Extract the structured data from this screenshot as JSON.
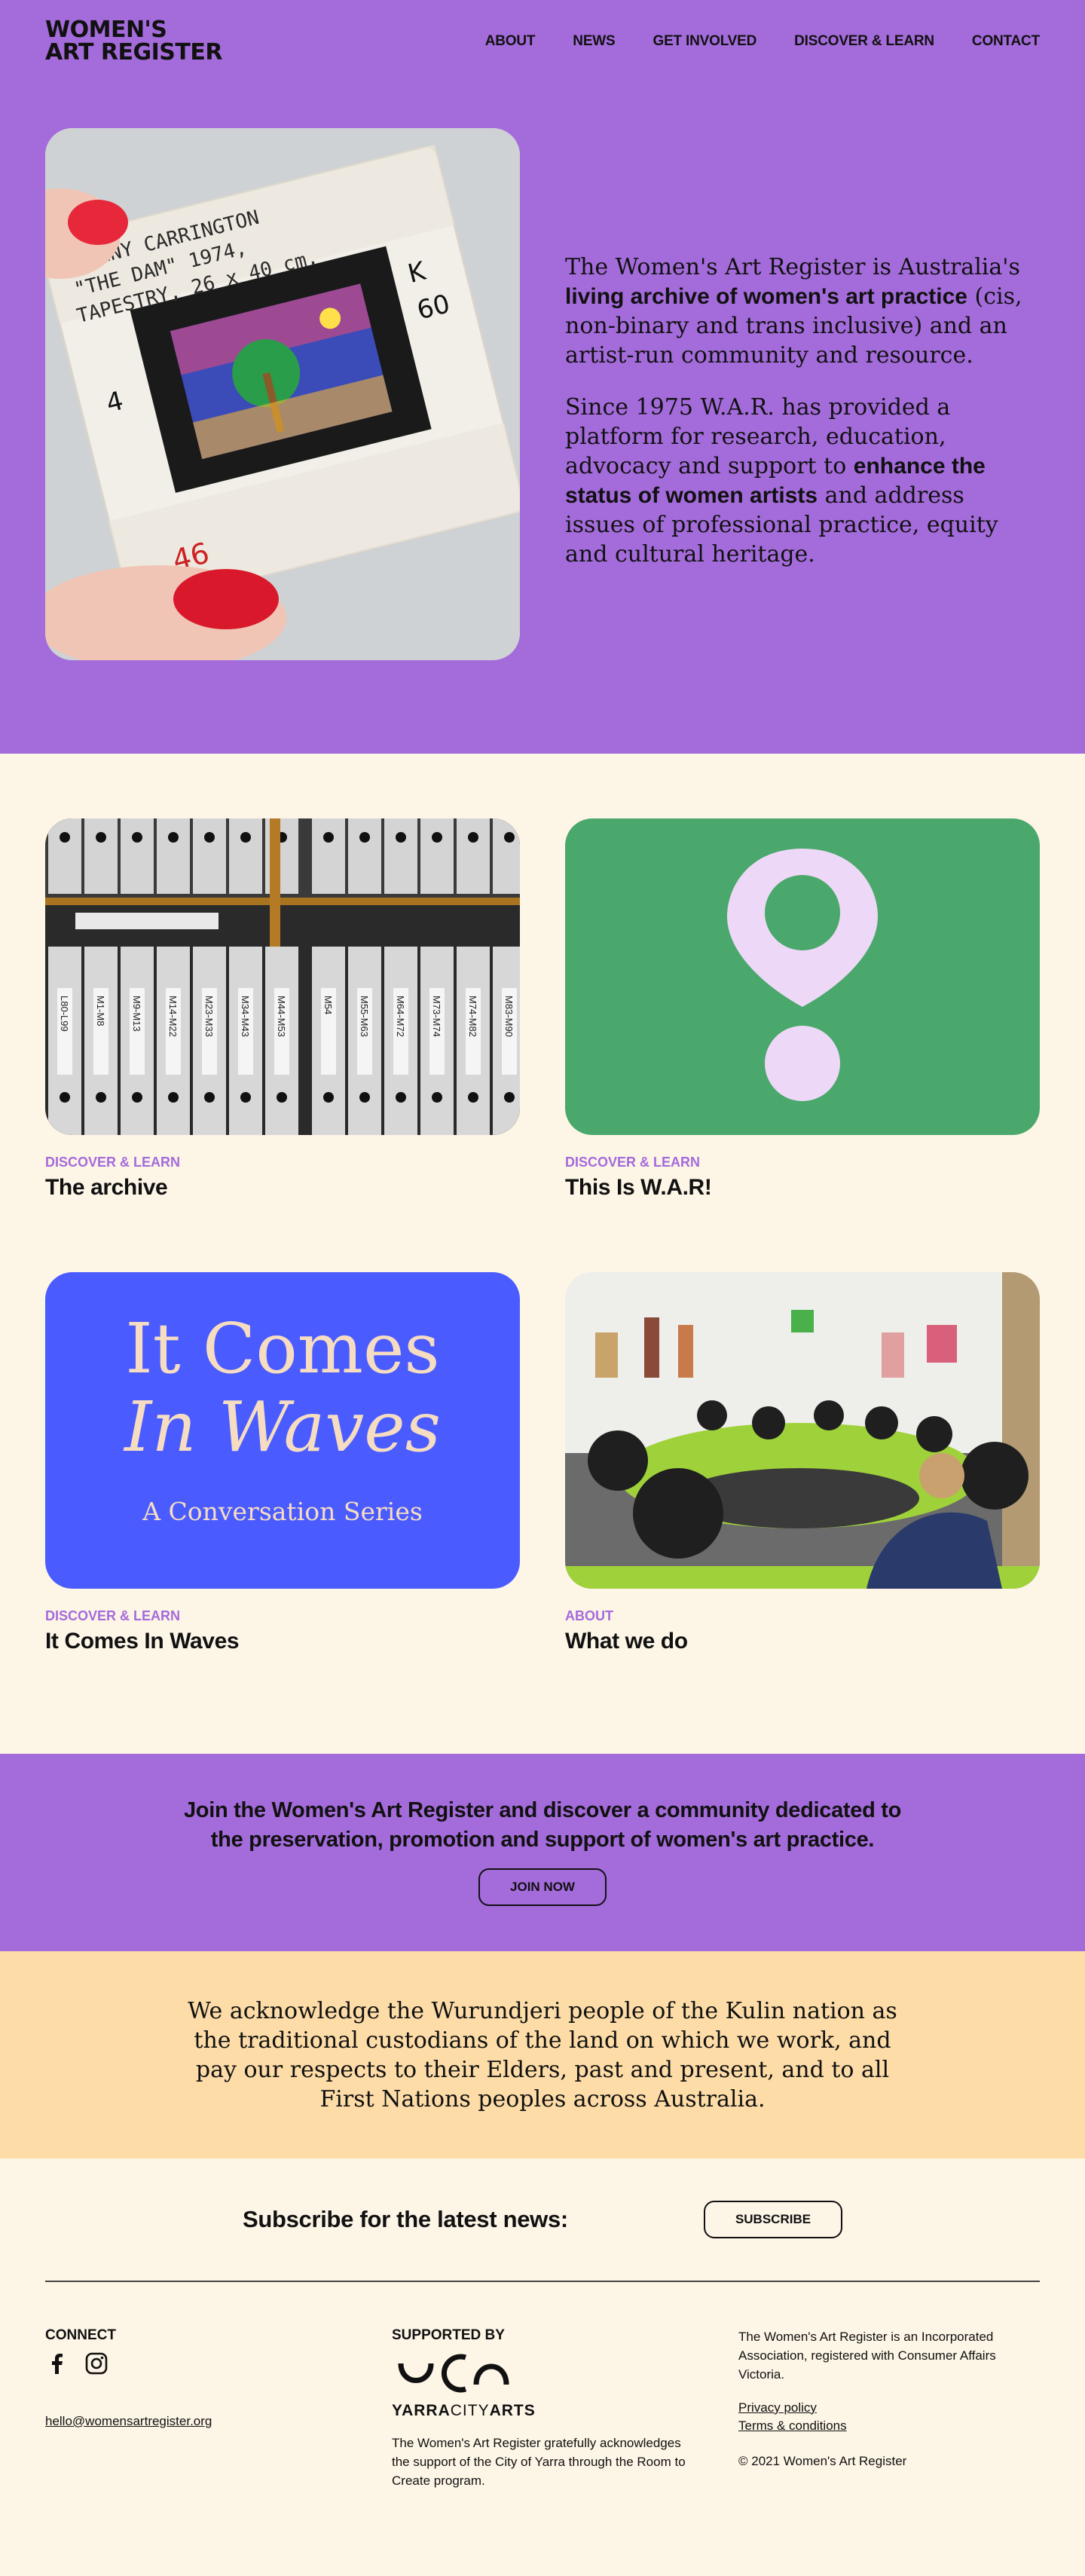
{
  "header": {
    "logo_line1": "WOMEN'S",
    "logo_line2": "ART REGISTER",
    "nav": [
      "ABOUT",
      "NEWS",
      "GET INVOLVED",
      "DISCOVER & LEARN",
      "CONTACT"
    ]
  },
  "hero": {
    "slide_handwriting": [
      "JENNY CARRINGTON",
      "\"THE DAM\" 1974,",
      "TAPESTRY, 26 x 40 cm."
    ],
    "slide_marks": [
      "K",
      "60",
      "4",
      "46"
    ],
    "p1_pre": "The Women's Art Register is Australia's ",
    "p1_bold": "living archive of women's art practice",
    "p1_post": " (cis, non-binary and trans inclusive) and an artist-run community and resource.",
    "p2_pre": "Since 1975 W.A.R. has provided a platform for research, education, advocacy and support to ",
    "p2_bold": "enhance the status of women artists",
    "p2_post": " and address issues of professional practice, equity and cultural heritage."
  },
  "cards": [
    {
      "category": "DISCOVER & LEARN",
      "title": "The archive",
      "binder_labels": [
        "L80-L99",
        "M1-M8",
        "M9-M13",
        "M14-M22",
        "M23-M33",
        "M34-M43",
        "M44-M53",
        "M54",
        "M55-M63",
        "M64-M72",
        "M73-M74",
        "M74-M82",
        "M83-M90"
      ]
    },
    {
      "category": "DISCOVER & LEARN",
      "title": "This Is W.A.R!"
    },
    {
      "category": "DISCOVER & LEARN",
      "title": "It Comes In Waves",
      "art_line1": "It Comes",
      "art_line2": "In Waves",
      "art_sub": "A Conversation Series"
    },
    {
      "category": "ABOUT",
      "title": "What we do"
    }
  ],
  "join": {
    "text": "Join the Women's Art Register and discover a community dedicated to the preservation, promotion and support of women's art practice.",
    "button": "JOIN NOW"
  },
  "acknowledgement": "We acknowledge the Wurundjeri people of the Kulin nation as the traditional custodians of the land on which we work, and pay our respects to their Elders, past and present, and to all First Nations peoples across Australia.",
  "subscribe": {
    "label": "Subscribe for the latest news:",
    "button": "SUBSCRIBE"
  },
  "footer": {
    "connect": "CONNECT",
    "email": "hello@womensartregister.org",
    "supported_by": "SUPPORTED BY",
    "yarra_bold1": "YARRA",
    "yarra_thin": "CITY",
    "yarra_bold2": "ARTS",
    "support_text": "The Women's Art Register gratefully acknowledges the support of the City of Yarra through the Room to Create program.",
    "incorporated": "The Women's Art Register is an Incorporated Association, registered with Consumer Affairs Victoria.",
    "privacy": "Privacy policy",
    "terms": "Terms & conditions",
    "copyright": "© 2021 Women's Art Register"
  },
  "colors": {
    "purple": "#a46bdb",
    "cream": "#fdf5e6",
    "peach": "#fddca7",
    "green": "#4aa86c",
    "blue": "#4a5cff",
    "pin": "#eed8f7"
  }
}
